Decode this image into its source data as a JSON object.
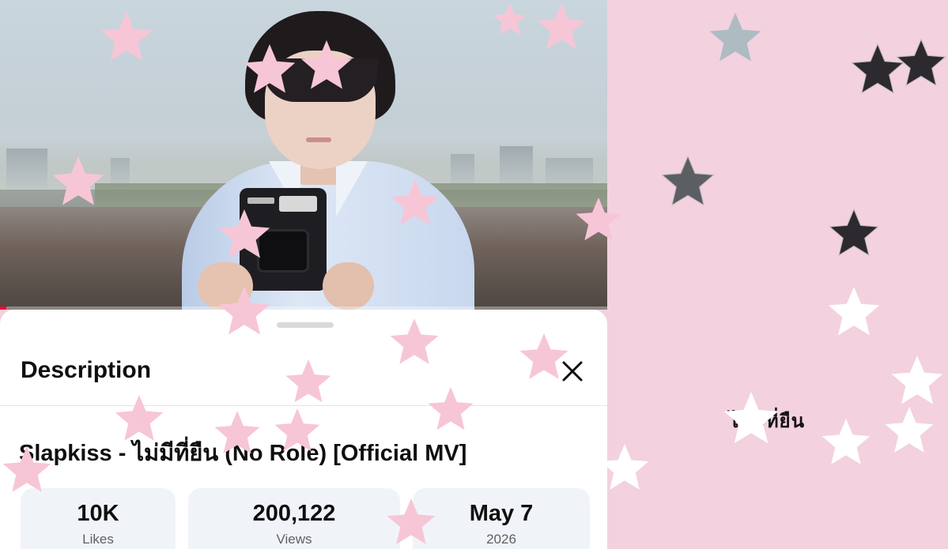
{
  "video": {
    "progress_percent": 1
  },
  "description_sheet": {
    "title": "Description",
    "video_title": "Slapkiss - ไม่มีที่ยืน (No Role) [Official MV]",
    "stats": [
      {
        "value": "10K",
        "label": "Likes"
      },
      {
        "value": "200,122",
        "label": "Views"
      },
      {
        "value": "May 7",
        "label": "2026"
      }
    ]
  },
  "right_panel": {
    "partial_text": "ไม่มีที่ยืน"
  },
  "colors": {
    "background_pink": "#f3d1df",
    "star_pink": "#f7c6d6",
    "progress_red": "#ff0033"
  },
  "icons": {
    "close": "close-icon",
    "decorations": "star-icon"
  }
}
